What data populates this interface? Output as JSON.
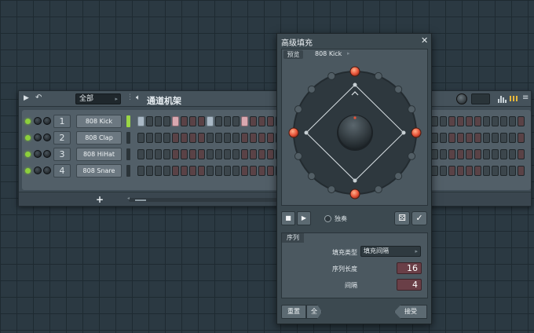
{
  "channel_rack": {
    "filter": "全部",
    "title": "通道机架",
    "add_label": "+",
    "channels": [
      {
        "number": "1",
        "name": "808 Kick",
        "selected": true
      },
      {
        "number": "2",
        "name": "808 Clap",
        "selected": false
      },
      {
        "number": "3",
        "name": "808 HiHat",
        "selected": false
      },
      {
        "number": "4",
        "name": "808 Snare",
        "selected": false
      }
    ],
    "kick_highlighted_steps": [
      1,
      5,
      9,
      13
    ],
    "colors": {
      "led_green": "#8ccf3c",
      "step_blue": "#aab9c6",
      "step_pink": "#d9a8b0"
    }
  },
  "dialog": {
    "title": "高级填充",
    "close": "✕",
    "preview": {
      "label": "预览",
      "channel": "808 Kick"
    },
    "transport": {
      "stop": "■",
      "play": "▶",
      "solo_label": "独奏",
      "dice": "⚄",
      "ok": "✓"
    },
    "sequence": {
      "label": "序列",
      "fill_type_label": "填充类型",
      "fill_type_value": "填充间隔",
      "length_label": "序列长度",
      "length_value": "16",
      "interval_label": "间隔",
      "interval_value": "4"
    },
    "footer": {
      "reset": "重置",
      "all": "全",
      "accept": "接受"
    },
    "colors": {
      "accent_red": "#e8543a",
      "value_bg": "#6a3f47"
    }
  }
}
